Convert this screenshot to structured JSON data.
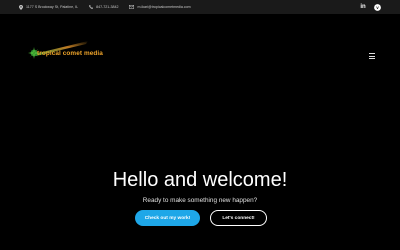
{
  "topbar": {
    "address": "1177 S Brockway St, Palatine, IL",
    "phone": "847-721-3842",
    "email": "m.ikari@tropicalcometmedia.com",
    "social": [
      {
        "name": "linkedin",
        "label": "in"
      },
      {
        "name": "vimeo",
        "label": "v"
      }
    ]
  },
  "brand": {
    "logo_text": "tropical comet media",
    "logo_color": "#f0a52a"
  },
  "hero": {
    "title": "Hello and welcome!",
    "subtitle": "Ready to make something new happen?",
    "primary_button": "Check out my work!",
    "secondary_button": "Let's connect!"
  },
  "colors": {
    "accent": "#1ea7e8",
    "background": "#000000",
    "topbar": "#1a1a1a"
  }
}
